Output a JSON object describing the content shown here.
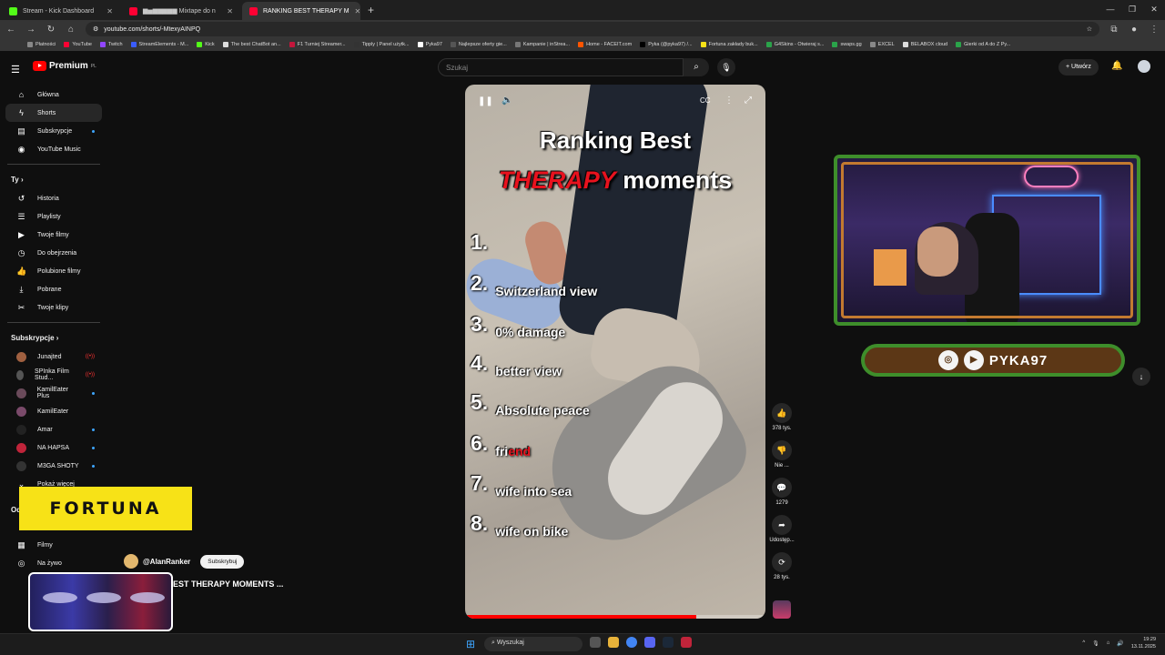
{
  "browser": {
    "tabs": [
      {
        "label": "Stream - Kick Dashboard",
        "color": "#53fc18",
        "active": false
      },
      {
        "label": "▆▅▆▆▆▆▆ Mixtape do n",
        "color": "#ff0033",
        "active": false
      },
      {
        "label": "RANKING BEST THERAPY M",
        "color": "#ff0033",
        "active": true
      }
    ],
    "url": "youtube.com/shorts/-MtexyAINPQ",
    "bookmarks": [
      {
        "label": "Płatności",
        "color": "#888888"
      },
      {
        "label": "YouTube",
        "color": "#ff0033"
      },
      {
        "label": "Twitch",
        "color": "#9146ff"
      },
      {
        "label": "StreamElements - M...",
        "color": "#3a5cff"
      },
      {
        "label": "Kick",
        "color": "#53fc18"
      },
      {
        "label": "The best ChatBot an...",
        "color": "#dddddd"
      },
      {
        "label": "F1 Turniej Streamer...",
        "color": "#c4163c"
      },
      {
        "label": "Tipply | Panel użytk...",
        "color": "#333333"
      },
      {
        "label": "Pyka97",
        "color": "#ffffff"
      },
      {
        "label": "Najlepsze oferty gie...",
        "color": "#555555"
      },
      {
        "label": "Kampanie | inStrea...",
        "color": "#777777"
      },
      {
        "label": "Home - FACEIT.com",
        "color": "#ff5500"
      },
      {
        "label": "Pyka (@pyka97) /...",
        "color": "#000000"
      },
      {
        "label": "Fortuna zakłady buk...",
        "color": "#f7e217"
      },
      {
        "label": "G4Skins - Otwieraj s...",
        "color": "#2aa34a"
      },
      {
        "label": "swaps.gg",
        "color": "#2aa34a"
      },
      {
        "label": "EXCEL",
        "color": "#888888"
      },
      {
        "label": "BELABOX cloud",
        "color": "#dddddd"
      },
      {
        "label": "Gierki od A do Z Py...",
        "color": "#2aa34a"
      }
    ]
  },
  "youtube": {
    "logo": "Premium",
    "logo_region": "PL",
    "search_placeholder": "Szukaj",
    "create_label": "Utwórz",
    "sidebar_main": [
      {
        "label": "Główna",
        "icon": "⌂",
        "active": false
      },
      {
        "label": "Shorts",
        "icon": "ϟ",
        "active": true
      },
      {
        "label": "Subskrypcje",
        "icon": "▤",
        "active": false,
        "dot": true
      },
      {
        "label": "YouTube Music",
        "icon": "◉",
        "active": false
      }
    ],
    "you_header": "Ty",
    "sidebar_you": [
      {
        "label": "Historia",
        "icon": "↺"
      },
      {
        "label": "Playlisty",
        "icon": "☰"
      },
      {
        "label": "Twoje filmy",
        "icon": "▶"
      },
      {
        "label": "Do obejrzenia",
        "icon": "◷"
      },
      {
        "label": "Polubione filmy",
        "icon": "👍"
      },
      {
        "label": "Pobrane",
        "icon": "⤓"
      },
      {
        "label": "Twoje klipy",
        "icon": "✂"
      }
    ],
    "subs_header": "Subskrypcje",
    "subscriptions": [
      {
        "label": "Junajted",
        "color": "#a06040",
        "live": true
      },
      {
        "label": "SPInka Film Stud...",
        "color": "#555555",
        "live": true
      },
      {
        "label": "KamilEater Plus",
        "color": "#6a4a5a",
        "dot": true
      },
      {
        "label": "KamilEater",
        "color": "#7a4a6a"
      },
      {
        "label": "Amar",
        "color": "#222222",
        "dot": true
      },
      {
        "label": "NA HAPSA",
        "color": "#c0243a",
        "dot": true
      },
      {
        "label": "M3GA SHOTY",
        "color": "#333333",
        "dot": true
      }
    ],
    "show_more": "Pokaż więcej",
    "explore_header": "Od",
    "sidebar_explore": [
      {
        "label": "Filmy",
        "icon": "▦"
      },
      {
        "label": "Na żywo",
        "icon": "◎"
      }
    ]
  },
  "short": {
    "title_line1": "Ranking Best",
    "title_red": "THERAPY",
    "title_line2": "moments",
    "ranks": [
      {
        "n": "1.",
        "text": "",
        "red": ""
      },
      {
        "n": "2.",
        "text": "Switzerland view",
        "red": ""
      },
      {
        "n": "3.",
        "text": "0% damage",
        "red": ""
      },
      {
        "n": "4.",
        "text": "better view",
        "red": ""
      },
      {
        "n": "5.",
        "text": "Absolute peace",
        "red": ""
      },
      {
        "n": "6.",
        "text": "fri",
        "red": "end"
      },
      {
        "n": "7.",
        "text": "wife into sea",
        "red": ""
      },
      {
        "n": "8.",
        "text": "wife on bike",
        "red": ""
      }
    ],
    "progress_fraction": 0.77,
    "actions": [
      {
        "icon": "👍",
        "label": "378 tys."
      },
      {
        "icon": "👎",
        "label": "Nie ..."
      },
      {
        "icon": "💬",
        "label": "1279"
      },
      {
        "icon": "➦",
        "label": "Udostęp..."
      },
      {
        "icon": "⟳",
        "label": "28 tys."
      }
    ],
    "channel_name": "@AlanRanker",
    "subscribe_label": "Subskrybuj",
    "short_title": "EST THERAPY MOMENTS ..."
  },
  "overlay": {
    "fortuna_text": "FORTUNA",
    "social_name": "PYKA97"
  },
  "taskbar": {
    "search_label": "Wyszukaj",
    "time": "19:29",
    "date": "13.11.2025"
  }
}
